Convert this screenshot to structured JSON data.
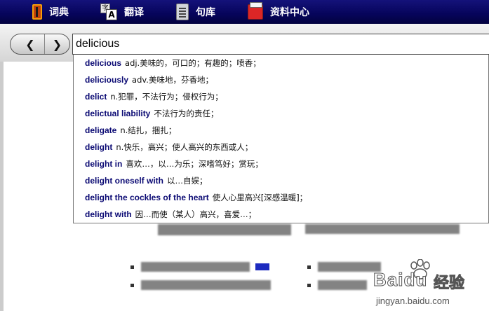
{
  "nav": {
    "tabs": [
      {
        "label": "词典",
        "icon": "dictionary-icon"
      },
      {
        "label": "翻译",
        "icon": "translate-icon",
        "icon_glyphs": [
          "字",
          "A"
        ]
      },
      {
        "label": "句库",
        "icon": "sentence-library-icon"
      },
      {
        "label": "资料中心",
        "icon": "data-center-icon"
      }
    ]
  },
  "search": {
    "back_label": "❮",
    "forward_label": "❯",
    "query": "delicious"
  },
  "suggestions": [
    {
      "word": "delicious",
      "definition": "adj.美味的，可口的；有趣的；喷香；"
    },
    {
      "word": "deliciously",
      "definition": "adv.美味地，芬香地；"
    },
    {
      "word": "delict",
      "definition": "n.犯罪，不法行为；侵权行为；"
    },
    {
      "word": "delictual liability",
      "definition": "不法行为的责任；"
    },
    {
      "word": "deligate",
      "definition": "n.结扎，捆扎；"
    },
    {
      "word": "delight",
      "definition": "n.快乐，高兴；使人高兴的东西或人；"
    },
    {
      "word": "delight in",
      "definition": "喜欢…，以…为乐；深嗜笃好；赏玩；"
    },
    {
      "word": "delight oneself with",
      "definition": "以…自娱；"
    },
    {
      "word": "delight the cockles of the heart",
      "definition": "使人心里高兴[深感温暖]；"
    },
    {
      "word": "delight with",
      "definition": "因…而使（某人）高兴，喜爱…；"
    }
  ],
  "watermark": {
    "brand": "Baidu",
    "brand_cn": "经验",
    "url": "jingyan.baidu.com"
  },
  "colors": {
    "topbar": "#06045a",
    "suggestion_word": "#0c0b74",
    "blue_mark": "#1d2bbf"
  }
}
